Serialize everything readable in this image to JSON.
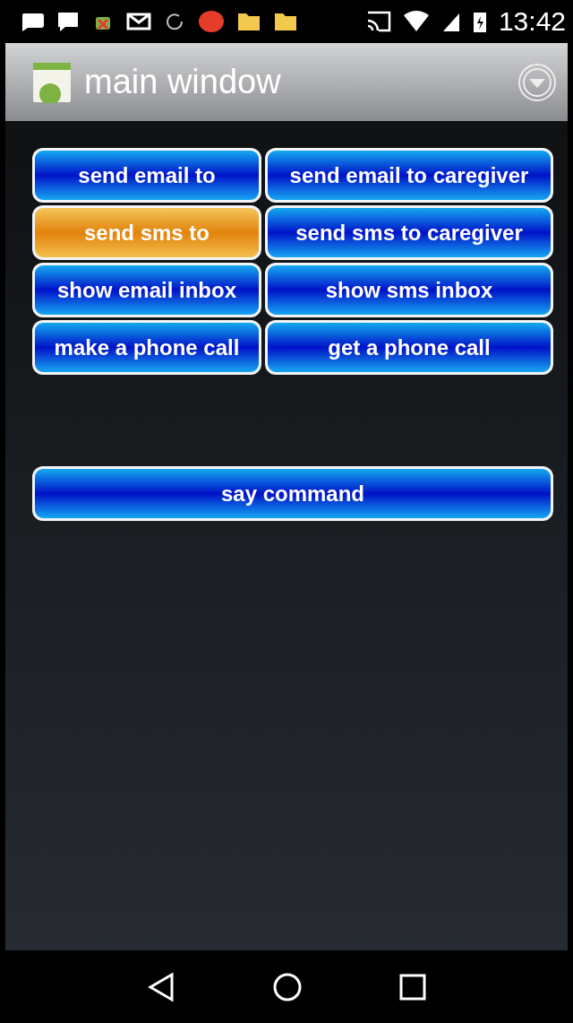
{
  "status_bar": {
    "time": "13:42"
  },
  "app_bar": {
    "title": "main window"
  },
  "buttons": [
    {
      "label": "send email to",
      "selected": false
    },
    {
      "label": "send email to caregiver",
      "selected": false
    },
    {
      "label": "send sms to",
      "selected": true
    },
    {
      "label": "send sms to caregiver",
      "selected": false
    },
    {
      "label": "show email inbox",
      "selected": false
    },
    {
      "label": "show sms inbox",
      "selected": false
    },
    {
      "label": "make a phone call",
      "selected": false
    },
    {
      "label": "get a phone call",
      "selected": false
    }
  ],
  "command_button": {
    "label": "say command",
    "selected": false
  }
}
